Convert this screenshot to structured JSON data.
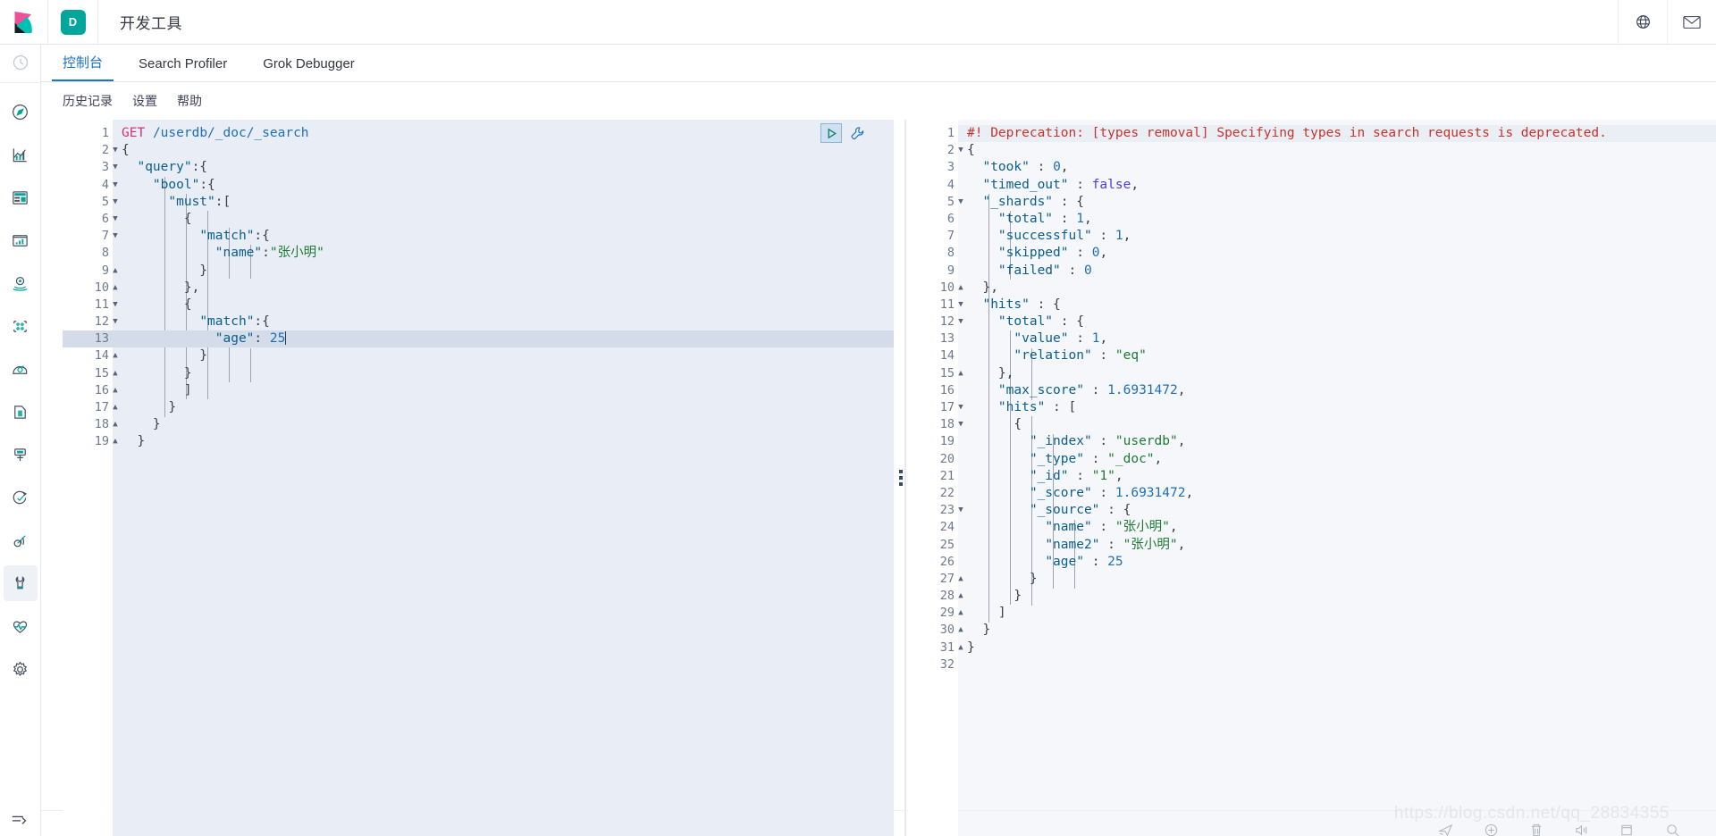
{
  "header": {
    "app_badge": "D",
    "title": "开发工具",
    "icons": [
      "globe-help-icon",
      "mail-icon"
    ]
  },
  "sidebar": {
    "top_icon": "recently-viewed-clock-icon",
    "items": [
      {
        "icon": "discover-compass-icon",
        "label": "Discover",
        "active": false
      },
      {
        "icon": "visualize-chart-icon",
        "label": "Visualize",
        "active": false
      },
      {
        "icon": "dashboard-icon",
        "label": "Dashboard",
        "active": false
      },
      {
        "icon": "canvas-icon",
        "label": "Canvas",
        "active": false
      },
      {
        "icon": "maps-pin-icon",
        "label": "Maps",
        "active": false
      },
      {
        "icon": "machine-learning-icon",
        "label": "Machine Learning",
        "active": false
      },
      {
        "icon": "infrastructure-icon",
        "label": "Infrastructure",
        "active": false
      },
      {
        "icon": "logs-icon",
        "label": "Logs",
        "active": false
      },
      {
        "icon": "apm-icon",
        "label": "APM",
        "active": false
      },
      {
        "icon": "uptime-clock-icon",
        "label": "Uptime",
        "active": false
      },
      {
        "icon": "siem-signal-icon",
        "label": "SIEM",
        "active": false
      },
      {
        "icon": "dev-tools-wrench-icon",
        "label": "Dev Tools",
        "active": true
      },
      {
        "icon": "monitoring-heartbeat-icon",
        "label": "Monitoring",
        "active": false
      },
      {
        "icon": "management-gear-icon",
        "label": "Management",
        "active": false
      }
    ],
    "collapse_icon": "collapse-arrow-icon"
  },
  "tabs": [
    {
      "label": "控制台",
      "active": true
    },
    {
      "label": "Search Profiler",
      "active": false
    },
    {
      "label": "Grok Debugger",
      "active": false
    }
  ],
  "submenu": [
    {
      "label": "历史记录"
    },
    {
      "label": "设置"
    },
    {
      "label": "帮助"
    }
  ],
  "console": {
    "run_button": "play-icon",
    "wrench_button": "wrench-icon",
    "splitter": "pane-resize-handle",
    "request": {
      "active_line": 13,
      "total_lines": 19,
      "lines": [
        {
          "n": 1,
          "fold": "",
          "tokens": [
            {
              "t": "method",
              "v": "GET"
            },
            {
              "t": "punc",
              "v": " "
            },
            {
              "t": "url",
              "v": "/userdb/_doc/_search"
            }
          ]
        },
        {
          "n": 2,
          "fold": "open",
          "tokens": [
            {
              "t": "punc",
              "v": "{"
            }
          ]
        },
        {
          "n": 3,
          "fold": "open",
          "tokens": [
            {
              "t": "punc",
              "v": "  "
            },
            {
              "t": "key",
              "v": "\"query\""
            },
            {
              "t": "punc",
              "v": ":{"
            }
          ]
        },
        {
          "n": 4,
          "fold": "open",
          "tokens": [
            {
              "t": "punc",
              "v": "    "
            },
            {
              "t": "key",
              "v": "\"bool\""
            },
            {
              "t": "punc",
              "v": ":{"
            }
          ]
        },
        {
          "n": 5,
          "fold": "open",
          "tokens": [
            {
              "t": "punc",
              "v": "      "
            },
            {
              "t": "key",
              "v": "\"must\""
            },
            {
              "t": "punc",
              "v": ":["
            }
          ]
        },
        {
          "n": 6,
          "fold": "open",
          "tokens": [
            {
              "t": "punc",
              "v": "        {"
            }
          ]
        },
        {
          "n": 7,
          "fold": "open",
          "tokens": [
            {
              "t": "punc",
              "v": "          "
            },
            {
              "t": "key",
              "v": "\"match\""
            },
            {
              "t": "punc",
              "v": ":{"
            }
          ]
        },
        {
          "n": 8,
          "fold": "",
          "tokens": [
            {
              "t": "punc",
              "v": "            "
            },
            {
              "t": "key",
              "v": "\"name\""
            },
            {
              "t": "punc",
              "v": ":"
            },
            {
              "t": "str",
              "v": "\"张小明\""
            }
          ]
        },
        {
          "n": 9,
          "fold": "close",
          "tokens": [
            {
              "t": "punc",
              "v": "          }"
            }
          ]
        },
        {
          "n": 10,
          "fold": "close",
          "tokens": [
            {
              "t": "punc",
              "v": "        },"
            }
          ]
        },
        {
          "n": 11,
          "fold": "open",
          "tokens": [
            {
              "t": "punc",
              "v": "        {"
            }
          ]
        },
        {
          "n": 12,
          "fold": "open",
          "tokens": [
            {
              "t": "punc",
              "v": "          "
            },
            {
              "t": "key",
              "v": "\"match\""
            },
            {
              "t": "punc",
              "v": ":{"
            }
          ]
        },
        {
          "n": 13,
          "fold": "",
          "tokens": [
            {
              "t": "punc",
              "v": "            "
            },
            {
              "t": "key",
              "v": "\"age\""
            },
            {
              "t": "punc",
              "v": ": "
            },
            {
              "t": "num",
              "v": "25"
            },
            {
              "t": "caret",
              "v": ""
            }
          ]
        },
        {
          "n": 14,
          "fold": "close",
          "tokens": [
            {
              "t": "punc",
              "v": "          }"
            }
          ]
        },
        {
          "n": 15,
          "fold": "close",
          "tokens": [
            {
              "t": "punc",
              "v": "        }"
            }
          ]
        },
        {
          "n": 16,
          "fold": "close",
          "tokens": [
            {
              "t": "punc",
              "v": "        ]"
            }
          ]
        },
        {
          "n": 17,
          "fold": "close",
          "tokens": [
            {
              "t": "punc",
              "v": "      }"
            }
          ]
        },
        {
          "n": 18,
          "fold": "close",
          "tokens": [
            {
              "t": "punc",
              "v": "    }"
            }
          ]
        },
        {
          "n": 19,
          "fold": "close",
          "tokens": [
            {
              "t": "punc",
              "v": "  }"
            }
          ]
        }
      ]
    },
    "response": {
      "total_lines": 32,
      "lines": [
        {
          "n": 1,
          "fold": "",
          "dep": true,
          "tokens": [
            {
              "t": "warn",
              "v": "#! Deprecation: [types removal] Specifying types in search requests is deprecated."
            }
          ]
        },
        {
          "n": 2,
          "fold": "open",
          "tokens": [
            {
              "t": "punc",
              "v": "{"
            }
          ]
        },
        {
          "n": 3,
          "fold": "",
          "tokens": [
            {
              "t": "punc",
              "v": "  "
            },
            {
              "t": "key",
              "v": "\"took\""
            },
            {
              "t": "punc",
              "v": " : "
            },
            {
              "t": "num",
              "v": "0"
            },
            {
              "t": "punc",
              "v": ","
            }
          ]
        },
        {
          "n": 4,
          "fold": "",
          "tokens": [
            {
              "t": "punc",
              "v": "  "
            },
            {
              "t": "key",
              "v": "\"timed_out\""
            },
            {
              "t": "punc",
              "v": " : "
            },
            {
              "t": "bool",
              "v": "false"
            },
            {
              "t": "punc",
              "v": ","
            }
          ]
        },
        {
          "n": 5,
          "fold": "open",
          "tokens": [
            {
              "t": "punc",
              "v": "  "
            },
            {
              "t": "key",
              "v": "\"_shards\""
            },
            {
              "t": "punc",
              "v": " : {"
            }
          ]
        },
        {
          "n": 6,
          "fold": "",
          "tokens": [
            {
              "t": "punc",
              "v": "    "
            },
            {
              "t": "key",
              "v": "\"total\""
            },
            {
              "t": "punc",
              "v": " : "
            },
            {
              "t": "num",
              "v": "1"
            },
            {
              "t": "punc",
              "v": ","
            }
          ]
        },
        {
          "n": 7,
          "fold": "",
          "tokens": [
            {
              "t": "punc",
              "v": "    "
            },
            {
              "t": "key",
              "v": "\"successful\""
            },
            {
              "t": "punc",
              "v": " : "
            },
            {
              "t": "num",
              "v": "1"
            },
            {
              "t": "punc",
              "v": ","
            }
          ]
        },
        {
          "n": 8,
          "fold": "",
          "tokens": [
            {
              "t": "punc",
              "v": "    "
            },
            {
              "t": "key",
              "v": "\"skipped\""
            },
            {
              "t": "punc",
              "v": " : "
            },
            {
              "t": "num",
              "v": "0"
            },
            {
              "t": "punc",
              "v": ","
            }
          ]
        },
        {
          "n": 9,
          "fold": "",
          "tokens": [
            {
              "t": "punc",
              "v": "    "
            },
            {
              "t": "key",
              "v": "\"failed\""
            },
            {
              "t": "punc",
              "v": " : "
            },
            {
              "t": "num",
              "v": "0"
            }
          ]
        },
        {
          "n": 10,
          "fold": "close",
          "tokens": [
            {
              "t": "punc",
              "v": "  },"
            }
          ]
        },
        {
          "n": 11,
          "fold": "open",
          "tokens": [
            {
              "t": "punc",
              "v": "  "
            },
            {
              "t": "key",
              "v": "\"hits\""
            },
            {
              "t": "punc",
              "v": " : {"
            }
          ]
        },
        {
          "n": 12,
          "fold": "open",
          "tokens": [
            {
              "t": "punc",
              "v": "    "
            },
            {
              "t": "key",
              "v": "\"total\""
            },
            {
              "t": "punc",
              "v": " : {"
            }
          ]
        },
        {
          "n": 13,
          "fold": "",
          "tokens": [
            {
              "t": "punc",
              "v": "      "
            },
            {
              "t": "key",
              "v": "\"value\""
            },
            {
              "t": "punc",
              "v": " : "
            },
            {
              "t": "num",
              "v": "1"
            },
            {
              "t": "punc",
              "v": ","
            }
          ]
        },
        {
          "n": 14,
          "fold": "",
          "tokens": [
            {
              "t": "punc",
              "v": "      "
            },
            {
              "t": "key",
              "v": "\"relation\""
            },
            {
              "t": "punc",
              "v": " : "
            },
            {
              "t": "str",
              "v": "\"eq\""
            }
          ]
        },
        {
          "n": 15,
          "fold": "close",
          "tokens": [
            {
              "t": "punc",
              "v": "    },"
            }
          ]
        },
        {
          "n": 16,
          "fold": "",
          "tokens": [
            {
              "t": "punc",
              "v": "    "
            },
            {
              "t": "key",
              "v": "\"max_score\""
            },
            {
              "t": "punc",
              "v": " : "
            },
            {
              "t": "num",
              "v": "1.6931472"
            },
            {
              "t": "punc",
              "v": ","
            }
          ]
        },
        {
          "n": 17,
          "fold": "open",
          "tokens": [
            {
              "t": "punc",
              "v": "    "
            },
            {
              "t": "key",
              "v": "\"hits\""
            },
            {
              "t": "punc",
              "v": " : ["
            }
          ]
        },
        {
          "n": 18,
          "fold": "open",
          "tokens": [
            {
              "t": "punc",
              "v": "      {"
            }
          ]
        },
        {
          "n": 19,
          "fold": "",
          "tokens": [
            {
              "t": "punc",
              "v": "        "
            },
            {
              "t": "key",
              "v": "\"_index\""
            },
            {
              "t": "punc",
              "v": " : "
            },
            {
              "t": "str",
              "v": "\"userdb\""
            },
            {
              "t": "punc",
              "v": ","
            }
          ]
        },
        {
          "n": 20,
          "fold": "",
          "tokens": [
            {
              "t": "punc",
              "v": "        "
            },
            {
              "t": "key",
              "v": "\"_type\""
            },
            {
              "t": "punc",
              "v": " : "
            },
            {
              "t": "str",
              "v": "\"_doc\""
            },
            {
              "t": "punc",
              "v": ","
            }
          ]
        },
        {
          "n": 21,
          "fold": "",
          "tokens": [
            {
              "t": "punc",
              "v": "        "
            },
            {
              "t": "key",
              "v": "\"_id\""
            },
            {
              "t": "punc",
              "v": " : "
            },
            {
              "t": "str",
              "v": "\"1\""
            },
            {
              "t": "punc",
              "v": ","
            }
          ]
        },
        {
          "n": 22,
          "fold": "",
          "tokens": [
            {
              "t": "punc",
              "v": "        "
            },
            {
              "t": "key",
              "v": "\"_score\""
            },
            {
              "t": "punc",
              "v": " : "
            },
            {
              "t": "num",
              "v": "1.6931472"
            },
            {
              "t": "punc",
              "v": ","
            }
          ]
        },
        {
          "n": 23,
          "fold": "open",
          "tokens": [
            {
              "t": "punc",
              "v": "        "
            },
            {
              "t": "key",
              "v": "\"_source\""
            },
            {
              "t": "punc",
              "v": " : {"
            }
          ]
        },
        {
          "n": 24,
          "fold": "",
          "tokens": [
            {
              "t": "punc",
              "v": "          "
            },
            {
              "t": "key",
              "v": "\"name\""
            },
            {
              "t": "punc",
              "v": " : "
            },
            {
              "t": "str",
              "v": "\"张小明\""
            },
            {
              "t": "punc",
              "v": ","
            }
          ]
        },
        {
          "n": 25,
          "fold": "",
          "tokens": [
            {
              "t": "punc",
              "v": "          "
            },
            {
              "t": "key",
              "v": "\"name2\""
            },
            {
              "t": "punc",
              "v": " : "
            },
            {
              "t": "str",
              "v": "\"张小明\""
            },
            {
              "t": "punc",
              "v": ","
            }
          ]
        },
        {
          "n": 26,
          "fold": "",
          "tokens": [
            {
              "t": "punc",
              "v": "          "
            },
            {
              "t": "key",
              "v": "\"age\""
            },
            {
              "t": "punc",
              "v": " : "
            },
            {
              "t": "num",
              "v": "25"
            }
          ]
        },
        {
          "n": 27,
          "fold": "close",
          "tokens": [
            {
              "t": "punc",
              "v": "        }"
            }
          ]
        },
        {
          "n": 28,
          "fold": "close",
          "tokens": [
            {
              "t": "punc",
              "v": "      }"
            }
          ]
        },
        {
          "n": 29,
          "fold": "close",
          "tokens": [
            {
              "t": "punc",
              "v": "    ]"
            }
          ]
        },
        {
          "n": 30,
          "fold": "close",
          "tokens": [
            {
              "t": "punc",
              "v": "  }"
            }
          ]
        },
        {
          "n": 31,
          "fold": "close",
          "tokens": [
            {
              "t": "punc",
              "v": "}"
            }
          ]
        },
        {
          "n": 32,
          "fold": "",
          "tokens": []
        }
      ]
    }
  },
  "watermark": {
    "text": "https://blog.csdn.net/qq_28834355",
    "icons": [
      "plane-icon",
      "compass-plus-icon",
      "trash-icon",
      "volume-icon",
      "window-icon",
      "search-icon"
    ]
  },
  "colors": {
    "accent": "#1a73c4",
    "badge": "#00a69b",
    "method": "#d6336c",
    "string": "#1f7a33",
    "number": "#1d6fb8",
    "warning": "#c8332b",
    "active_line": "#d3dce8"
  }
}
